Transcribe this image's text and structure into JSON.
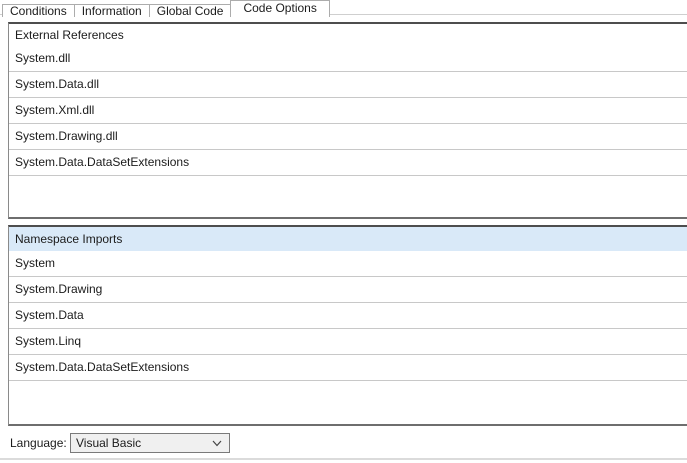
{
  "tabs": [
    {
      "label": "Conditions",
      "active": false
    },
    {
      "label": "Information",
      "active": false
    },
    {
      "label": "Global Code",
      "active": false
    },
    {
      "label": "Code Options",
      "active": true
    }
  ],
  "external_references": {
    "header": "External References",
    "items": [
      "System.dll",
      "System.Data.dll",
      "System.Xml.dll",
      "System.Drawing.dll",
      "System.Data.DataSetExtensions"
    ]
  },
  "namespace_imports": {
    "header": "Namespace Imports",
    "items": [
      "System",
      "System.Drawing",
      "System.Data",
      "System.Linq",
      "System.Data.DataSetExtensions"
    ]
  },
  "language": {
    "label": "Language:",
    "selected": "Visual Basic"
  },
  "icons": {
    "combo_arrow": "chevron-down-icon"
  },
  "colors": {
    "selected_header_bg": "#d9e9f8",
    "row_separator": "#c8c8c8",
    "list_border_dark": "#4d4d4d",
    "list_border_side": "#8a8a8a",
    "tab_border": "#acacac",
    "tabstrip_line": "#cfcfcf",
    "combo_bg": "#f0f0f0",
    "combo_border": "#7a7a7a",
    "bottom_rule": "#dbdbdb"
  }
}
